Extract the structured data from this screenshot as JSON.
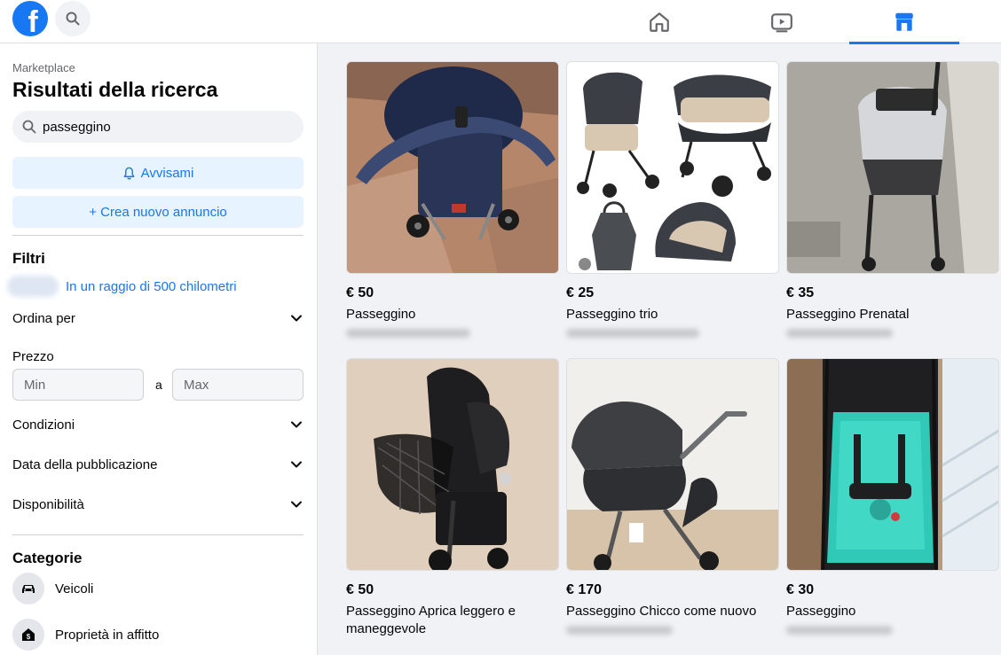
{
  "topbar": {
    "logo_letter": "f",
    "nav": [
      {
        "icon": "home-icon"
      },
      {
        "icon": "video-icon"
      },
      {
        "icon": "marketplace-icon",
        "active": true
      }
    ],
    "accent": "#1877f2"
  },
  "sidebar": {
    "breadcrumb": "Marketplace",
    "title": "Risultati della ricerca",
    "search": {
      "value": "passeggino"
    },
    "notify_label": "Avvisami",
    "create_label": "+ Crea nuovo annuncio",
    "filters_title": "Filtri",
    "radius_label": "In un raggio di 500 chilometri",
    "sort_label": "Ordina per",
    "price_label": "Prezzo",
    "price_min_placeholder": "Min",
    "price_sep": "a",
    "price_max_placeholder": "Max",
    "condition_label": "Condizioni",
    "date_label": "Data della pubblicazione",
    "availability_label": "Disponibilità",
    "categories_title": "Categorie",
    "categories": [
      {
        "label": "Veicoli",
        "icon": "car-icon"
      },
      {
        "label": "Proprietà in affitto",
        "icon": "house-dollar-icon"
      }
    ]
  },
  "listings": [
    {
      "price": "€ 50",
      "title": "Passeggino"
    },
    {
      "price": "€ 25",
      "title": "Passeggino trio"
    },
    {
      "price": "€ 35",
      "title": "Passeggino Prenatal"
    },
    {
      "price": "€ 50",
      "title": "Passeggino Aprica leggero e maneggevole"
    },
    {
      "price": "€ 170",
      "title": "Passeggino Chicco come nuovo"
    },
    {
      "price": "€ 30",
      "title": "Passeggino"
    }
  ]
}
